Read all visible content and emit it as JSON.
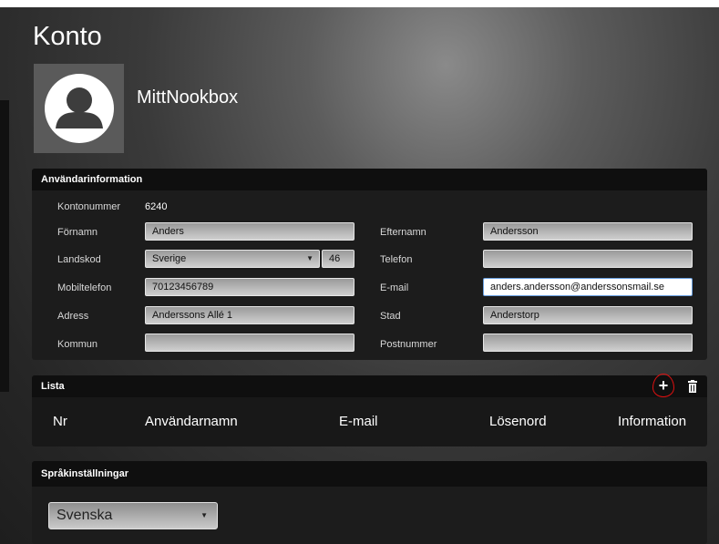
{
  "page": {
    "title": "Konto",
    "account_name": "MittNookbox"
  },
  "user_info": {
    "heading": "Användarinformation",
    "account_number": {
      "label": "Kontonummer",
      "value": "6240"
    },
    "first_name": {
      "label": "Förnamn",
      "value": "Anders"
    },
    "last_name": {
      "label": "Efternamn",
      "value": "Andersson"
    },
    "country_code": {
      "label": "Landskod",
      "value": "Sverige",
      "code": "46"
    },
    "phone": {
      "label": "Telefon",
      "value": ""
    },
    "mobile": {
      "label": "Mobiltelefon",
      "value": "70123456789"
    },
    "email": {
      "label": "E-mail",
      "value": "anders.andersson@anderssonsmail.se"
    },
    "address": {
      "label": "Adress",
      "value": "Anderssons Allé 1"
    },
    "city": {
      "label": "Stad",
      "value": "Anderstorp"
    },
    "municipality": {
      "label": "Kommun",
      "value": ""
    },
    "postal_code": {
      "label": "Postnummer",
      "value": ""
    }
  },
  "list": {
    "heading": "Lista",
    "columns": [
      "Nr",
      "Användarnamn",
      "E-mail",
      "Lösenord",
      "Information"
    ]
  },
  "language": {
    "heading": "Språkinställningar",
    "selected": "Svenska"
  },
  "icons": {
    "avatar": "user-avatar-icon",
    "add": "plus-icon",
    "delete": "trash-icon"
  },
  "colors": {
    "highlight": "#e01010",
    "focus_border": "#6aa0e0"
  }
}
